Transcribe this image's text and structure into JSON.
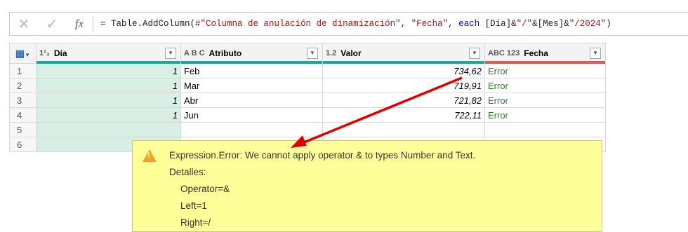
{
  "formula_bar": {
    "cancel_glyph": "✕",
    "confirm_glyph": "✓",
    "fx_label": "fx",
    "parts": {
      "p1": "= Table.AddColumn(#",
      "s1": "\"Columna de anulación de dinamización\"",
      "p2": ", ",
      "s2": "\"Fecha\"",
      "p3": ", ",
      "k1": "each",
      "p4": " [Día]&",
      "s3": "\"/\"",
      "p5": "&[Mes]&",
      "s4": "\"/2024\"",
      "p6": ")"
    }
  },
  "table": {
    "columns": [
      {
        "type_icon": "1²₃",
        "label": "Día",
        "bar_color": "#1aa99b"
      },
      {
        "type_icon": "A B C",
        "label": "Atributo",
        "bar_color": "#1aa99b"
      },
      {
        "type_icon": "1.2",
        "label": "Valor",
        "bar_color": "#1aa99b"
      },
      {
        "type_icon": "ABC 123",
        "label": "Fecha",
        "bar_color": "#e15a52"
      }
    ],
    "rows": [
      {
        "n": "1",
        "dia": "1",
        "attr": "Feb",
        "val": "734,62",
        "fecha": "Error"
      },
      {
        "n": "2",
        "dia": "1",
        "attr": "Mar",
        "val": "719,91",
        "fecha": "Error"
      },
      {
        "n": "3",
        "dia": "1",
        "attr": "Abr",
        "val": "721,82",
        "fecha": "Error"
      },
      {
        "n": "4",
        "dia": "1",
        "attr": "Jun",
        "val": "722,11",
        "fecha": "Error"
      },
      {
        "n": "5",
        "dia": "",
        "attr": "",
        "val": "",
        "fecha": ""
      },
      {
        "n": "6",
        "dia": "",
        "attr": "",
        "val": "",
        "fecha": ""
      }
    ]
  },
  "tooltip": {
    "icon": "warning-icon",
    "message": "Expression.Error: We cannot apply operator & to types Number and Text.",
    "details_label": "Detalles:",
    "operator": "Operator=&",
    "left": "Left=1",
    "right": "Right=/"
  },
  "colors": {
    "arrow": "#e00000",
    "tooltip_bg": "#ffff99"
  }
}
